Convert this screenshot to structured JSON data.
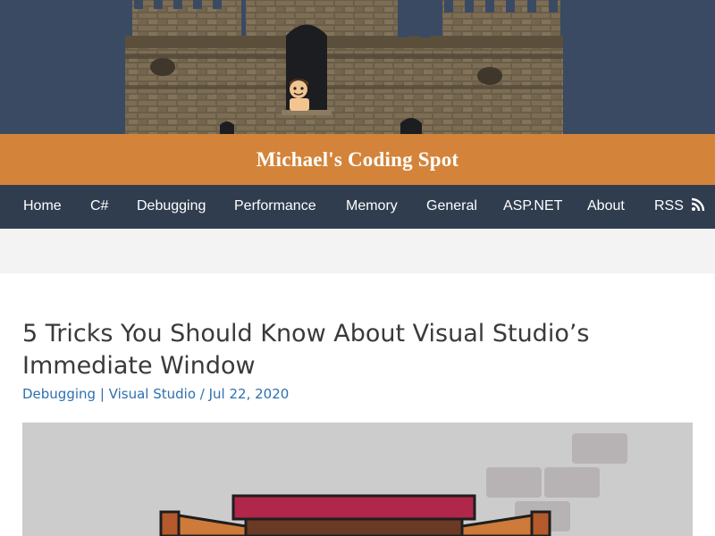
{
  "site": {
    "title": "Michael's Coding Spot"
  },
  "nav": {
    "items": [
      {
        "label": "Home"
      },
      {
        "label": "C#"
      },
      {
        "label": "Debugging"
      },
      {
        "label": "Performance"
      },
      {
        "label": "Memory"
      },
      {
        "label": "General"
      },
      {
        "label": "ASP.NET"
      },
      {
        "label": "About"
      },
      {
        "label": "RSS"
      }
    ]
  },
  "post": {
    "title": "5 Tricks You Should Know About Visual Studio’s Immediate Window",
    "categories": [
      "Debugging",
      "Visual Studio"
    ],
    "category_separator": "|",
    "date_separator": "/",
    "date": "Jul 22, 2020"
  },
  "colors": {
    "banner_bg": "#3a4a63",
    "title_bar": "#d4843a",
    "nav_bg": "#2f3d4f",
    "link": "#2e6fb0"
  },
  "icons": {
    "rss": "rss-icon"
  }
}
